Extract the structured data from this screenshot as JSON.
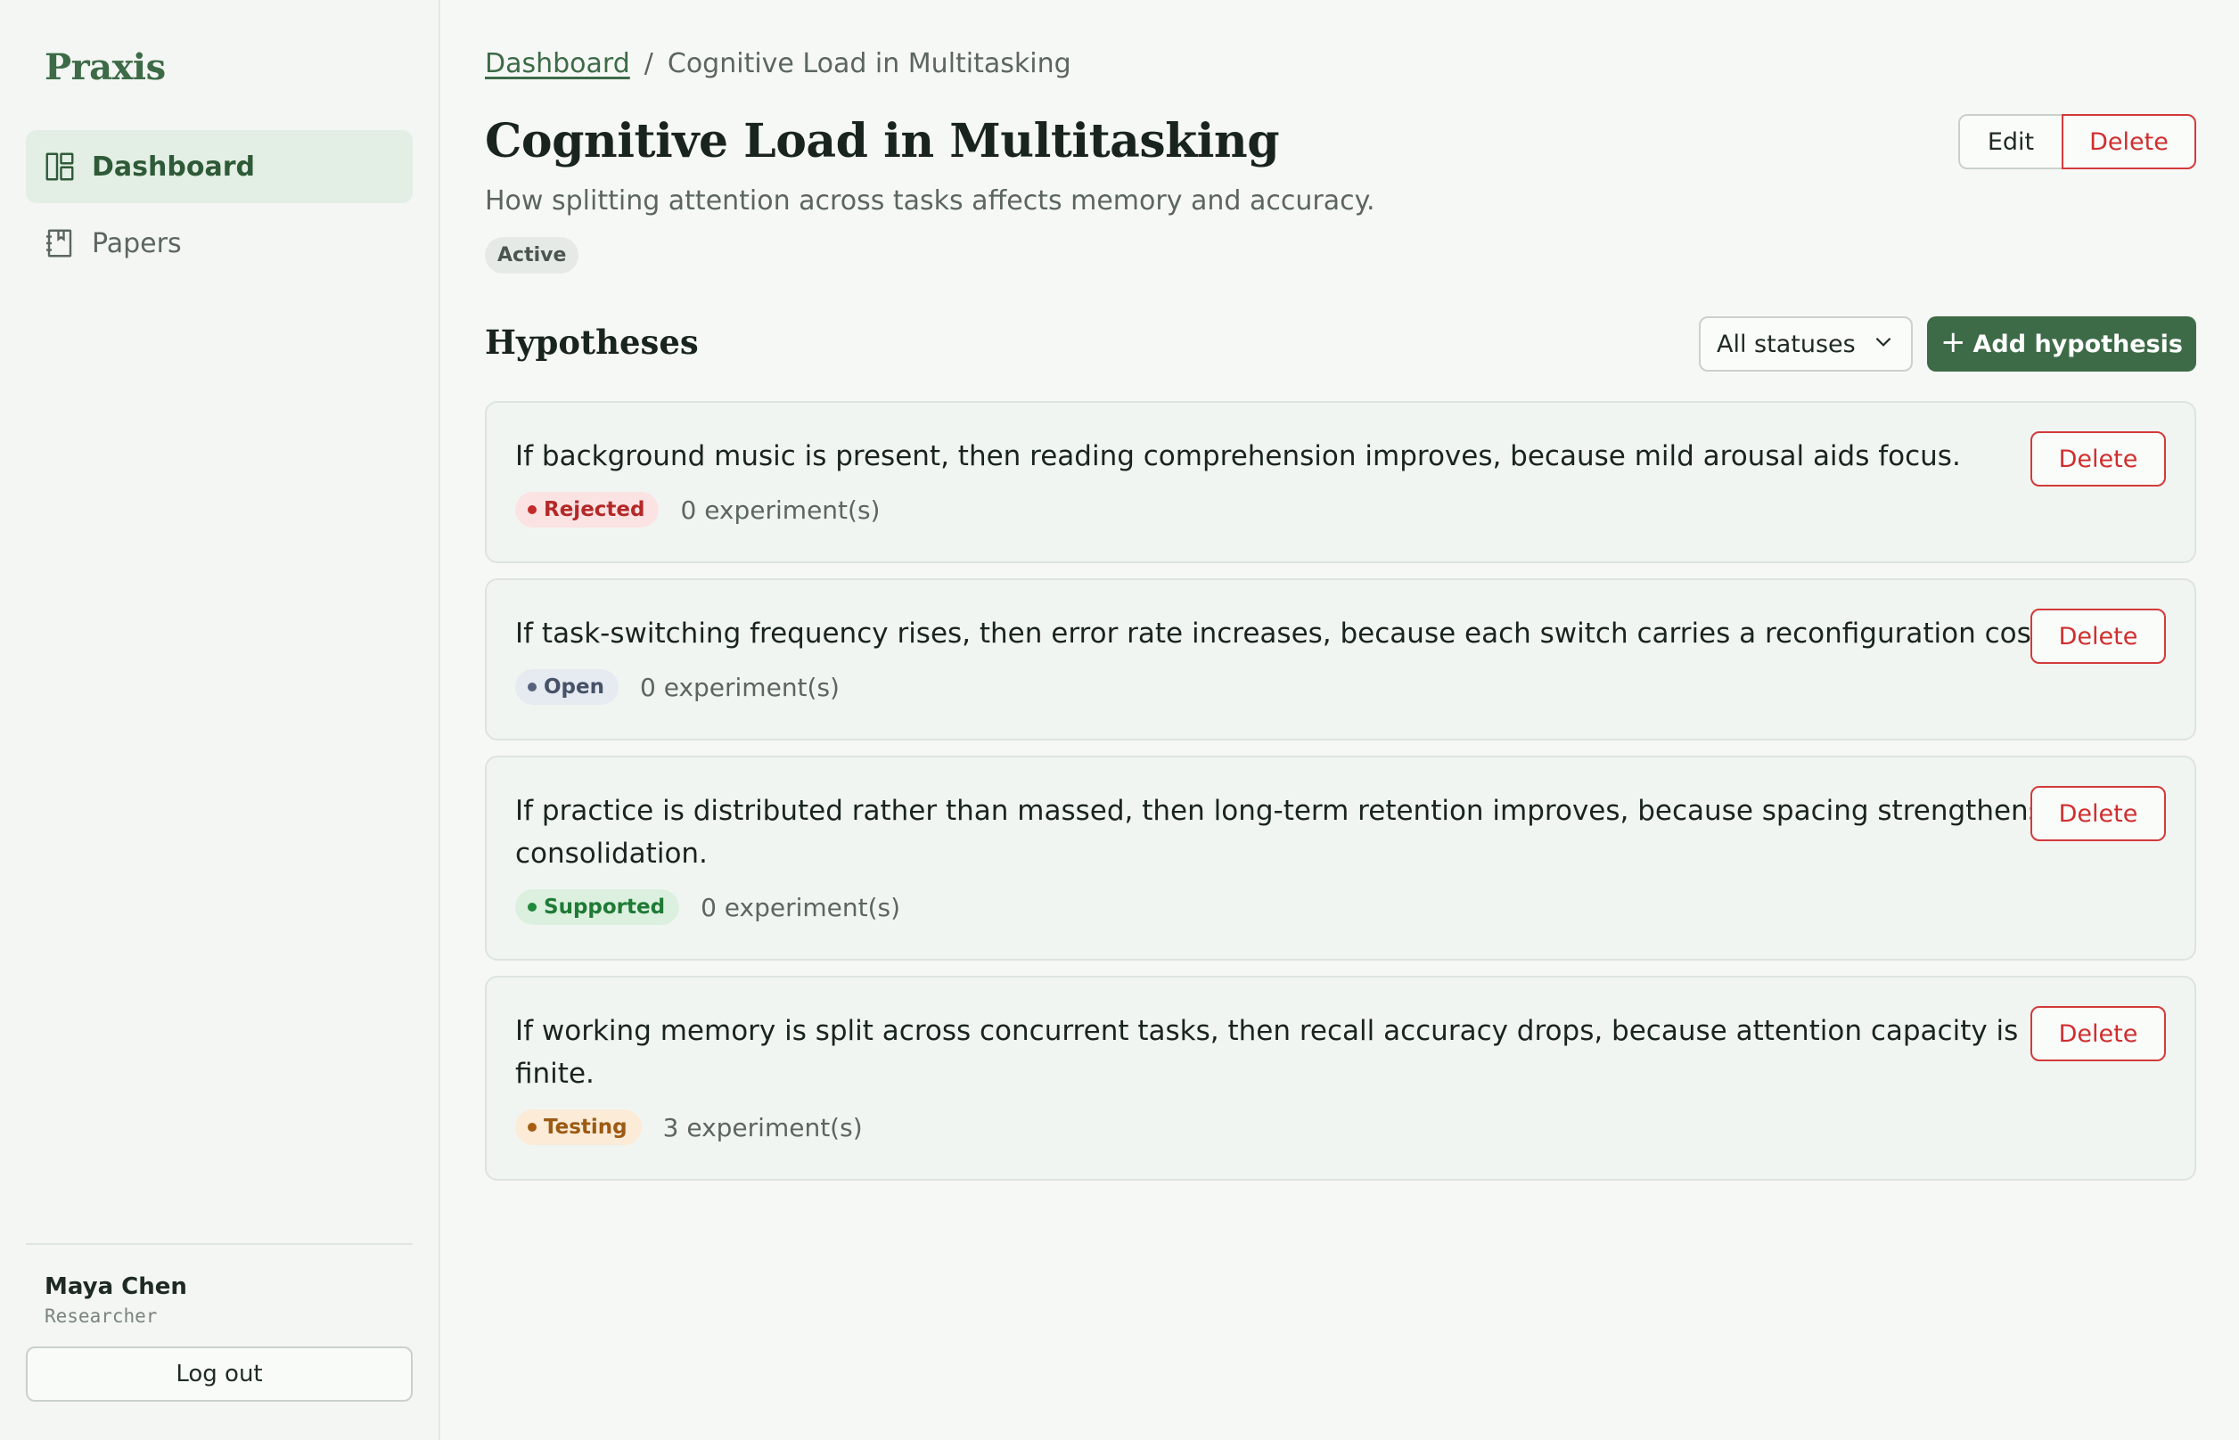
{
  "app": {
    "brand": "Praxis"
  },
  "sidebar": {
    "items": [
      {
        "label": "Dashboard",
        "icon": "dashboard-icon",
        "active": true
      },
      {
        "label": "Papers",
        "icon": "notebook-icon",
        "active": false
      }
    ],
    "user": {
      "name": "Maya Chen",
      "role": "Researcher"
    },
    "logout_label": "Log out"
  },
  "breadcrumb": {
    "root": "Dashboard",
    "separator": "/",
    "current": "Cognitive Load in Multitasking"
  },
  "project": {
    "title": "Cognitive Load in Multitasking",
    "description": "How splitting attention across tasks affects memory and accuracy.",
    "status": "Active",
    "edit_label": "Edit",
    "delete_label": "Delete"
  },
  "hypotheses": {
    "title": "Hypotheses",
    "filter": {
      "selected": "All statuses"
    },
    "add_label": "Add hypothesis",
    "add_icon": "+",
    "items": [
      {
        "text": "If background music is present, then reading comprehension improves, because mild arousal aids focus.",
        "status": "Rejected",
        "experiments": "0 experiment(s)",
        "delete_label": "Delete"
      },
      {
        "text": "If task-switching frequency rises, then error rate increases, because each switch carries a reconfiguration cost.",
        "status": "Open",
        "experiments": "0 experiment(s)",
        "delete_label": "Delete"
      },
      {
        "text": "If practice is distributed rather than massed, then long-term retention improves, because spacing strengthens consolidation.",
        "status": "Supported",
        "experiments": "0 experiment(s)",
        "delete_label": "Delete"
      },
      {
        "text": "If working memory is split across concurrent tasks, then recall accuracy drops, because attention capacity is finite.",
        "status": "Testing",
        "experiments": "3 experiment(s)",
        "delete_label": "Delete"
      }
    ]
  },
  "colors": {
    "accent": "#3d6b47",
    "danger": "#d02e2e",
    "rejected": "#b42828",
    "open": "#465267",
    "supported": "#1f7a35",
    "testing": "#9c5a12"
  }
}
